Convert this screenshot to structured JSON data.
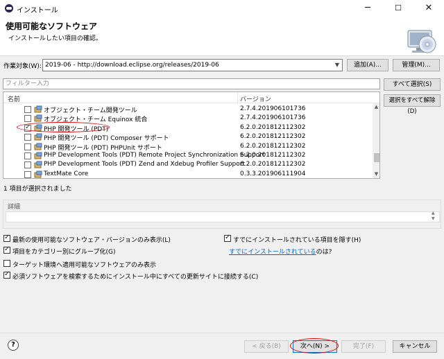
{
  "window": {
    "title": "インストール",
    "controls": {
      "minimize": "─",
      "maximize": "☐",
      "close": "✕"
    }
  },
  "header": {
    "title": "使用可能なソフトウェア",
    "subtitle": "インストールしたい項目の確認。"
  },
  "work_with": {
    "label": "作業対象(W):",
    "value": "2019-06 - http://download.eclipse.org/releases/2019-06",
    "add_button": "追加(A)...",
    "manage_button": "管理(M)..."
  },
  "filter": {
    "placeholder": "フィルター入力"
  },
  "side_buttons": {
    "select_all": "すべて選択(S)",
    "deselect_all": "選択をすべて解除(D)"
  },
  "table": {
    "columns": [
      "名前",
      "バージョン"
    ],
    "rows": [
      {
        "name": "オブジェクト・チーム開発ツール",
        "version": "2.7.4.201906101736",
        "checked": false
      },
      {
        "name": "オブジェクト・チーム Equinox 統合",
        "version": "2.7.4.201906101736",
        "checked": false
      },
      {
        "name": "PHP 開発ツール (PDT)",
        "version": "6.2.0.201812112302",
        "checked": true
      },
      {
        "name": "PHP 開発ツール (PDT) Composer サポート",
        "version": "6.2.0.201812112302",
        "checked": false
      },
      {
        "name": "PHP 開発ツール (PDT) PHPUnit サポート",
        "version": "6.2.0.201812112302",
        "checked": false
      },
      {
        "name": "PHP Development Tools (PDT) Remote Project Synchronization Support",
        "version": "6.2.0.201812112302",
        "checked": false
      },
      {
        "name": "PHP Development Tools (PDT) Zend and Xdebug Profiler Support",
        "version": "6.2.0.201812112302",
        "checked": false
      },
      {
        "name": "TextMate Core",
        "version": "0.3.3.201906111904",
        "checked": false
      }
    ]
  },
  "selection_status": "1 項目が選択されました",
  "details": {
    "label": "詳細"
  },
  "options": {
    "latest_only": "最新の使用可能なソフトウェア・バージョンのみ表示(L)",
    "group_by_category": "項目をカテゴリー別にグループ化(G)",
    "target_env_only": "ターゲット環境へ適用可能なソフトウェアのみ表示",
    "contact_all_sites": "必須ソフトウェアを検索するためにインストール中にすべての更新サイトに接続する(C)",
    "hide_installed": "すでにインストールされている項目を隠す(H)",
    "installed_link": "すでにインストールされている",
    "installed_suffix": "のは?"
  },
  "footer": {
    "help": "?",
    "back": "< 戻る(B)",
    "next": "次へ(N) >",
    "finish": "完了(F)",
    "cancel": "キャンセル"
  }
}
